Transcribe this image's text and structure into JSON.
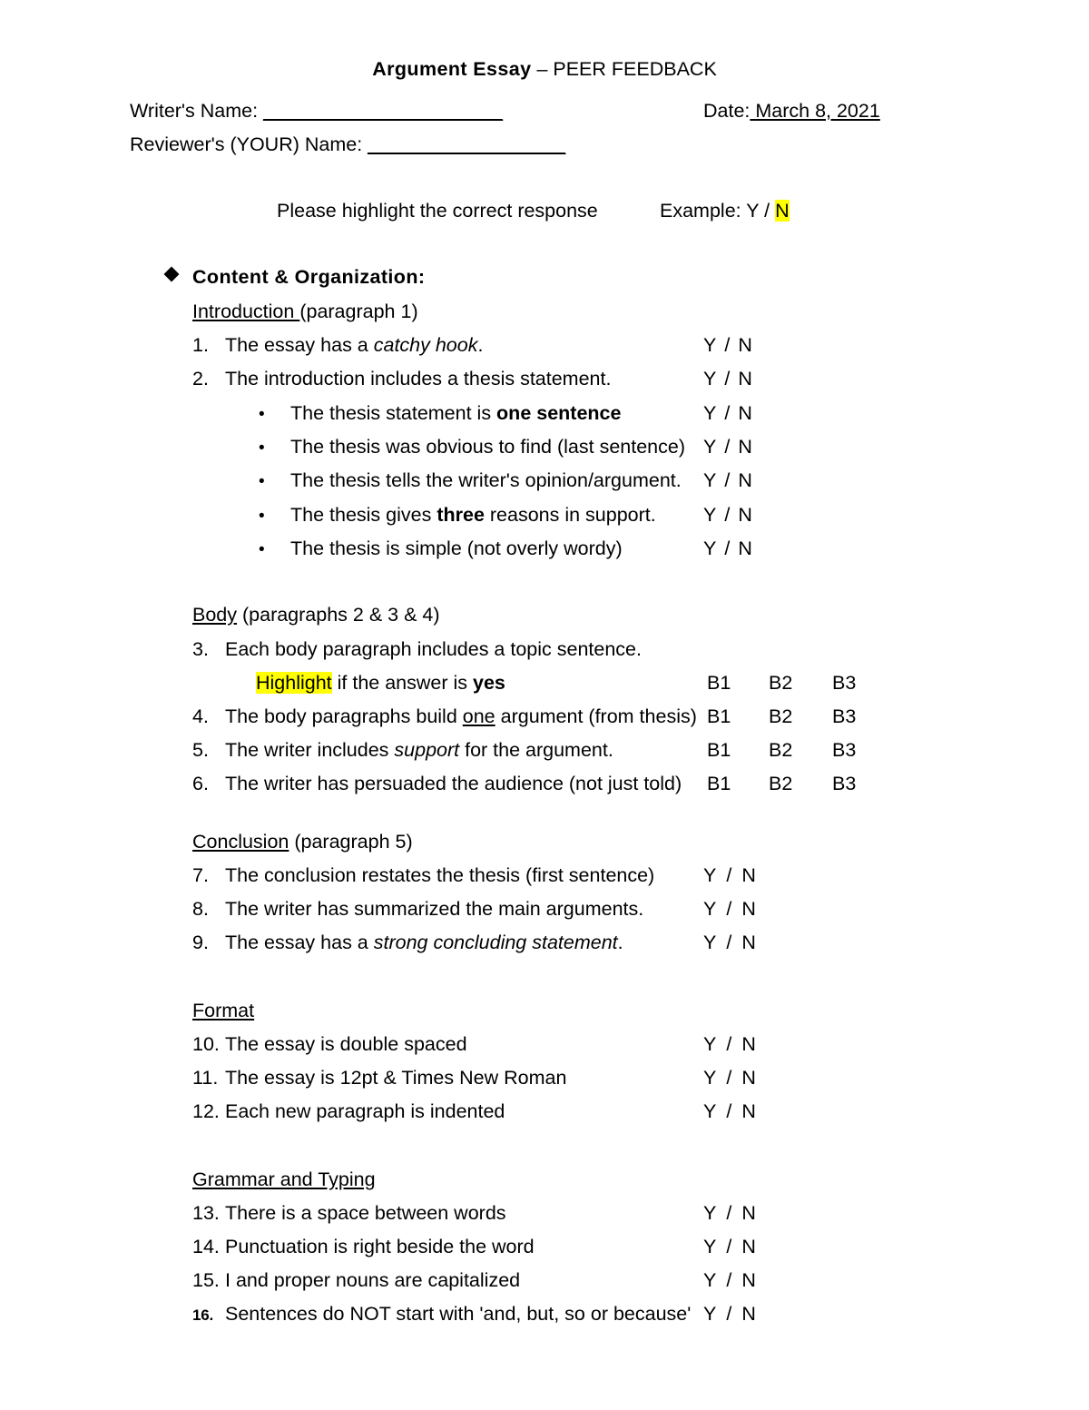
{
  "document": {
    "title_bold": "Argument Essay",
    "title_rest": " – PEER FEEDBACK",
    "writer_label": "Writer's Name: ",
    "writer_blank": "_______________________",
    "date_label": "Date:",
    "date_value": " March 8, 2021 ",
    "reviewer_label": "Reviewer's (YOUR) Name: ",
    "reviewer_blank": "___________________",
    "instruction": "Please highlight the correct response",
    "example_label": "Example: Y  /  ",
    "example_highlight": "N",
    "section_heading": "Content & Organization:"
  },
  "answers": {
    "yes": "Y",
    "slash": "/",
    "no": "N",
    "b1": "B1",
    "b2": "B2",
    "b3": "B3"
  },
  "subsections": {
    "introduction": {
      "name": "Introduction ",
      "detail": "(paragraph 1)"
    },
    "body": {
      "name": "Body",
      "detail": " (paragraphs 2 & 3 & 4)"
    },
    "conclusion": {
      "name": "Conclusion",
      "detail": " (paragraph 5)"
    },
    "format": {
      "name": "Format",
      "detail": ""
    },
    "grammar": {
      "name": "Grammar and Typing",
      "detail": ""
    }
  },
  "items": {
    "n1": {
      "number": "1.",
      "text_a": "The essay has a ",
      "text_italic": "catchy hook",
      "text_b": "."
    },
    "n2": {
      "number": "2.",
      "text_a": "The introduction includes a thesis statement."
    },
    "b1": {
      "text_a": "The thesis statement is ",
      "text_bold": "one sentence"
    },
    "b2": {
      "text_a": "The thesis was obvious to find (last sentence)"
    },
    "b3": {
      "text_a": "The thesis tells the writer's opinion/argument."
    },
    "b4": {
      "text_a": "The thesis gives ",
      "text_bold": "three",
      "text_b": " reasons in support."
    },
    "b5": {
      "text_a": "The thesis is simple (not overly wordy)"
    },
    "n3": {
      "number": "3.",
      "text_a": "Each body paragraph includes a topic sentence."
    },
    "n3sub": {
      "highlight": "Highlight",
      "text_a": " if the answer is ",
      "text_bold": "yes"
    },
    "n4": {
      "number": "4.",
      "text_a": "The body paragraphs build ",
      "text_underline": "one",
      "text_b": " argument (from thesis)"
    },
    "n5": {
      "number": "5.",
      "text_a": "The writer includes ",
      "text_italic": "support",
      "text_b": " for the argument."
    },
    "n6": {
      "number": "6.",
      "text_a": "The writer has persuaded the audience (not just told)"
    },
    "n7": {
      "number": "7.",
      "text_a": "The conclusion restates the thesis (first sentence)"
    },
    "n8": {
      "number": "8.",
      "text_a": "The writer has summarized the main arguments."
    },
    "n9": {
      "number": "9.",
      "text_a": "The essay has a ",
      "text_italic": "strong concluding statement",
      "text_b": "."
    },
    "n10": {
      "number": "10.",
      "text_a": "The essay is double spaced"
    },
    "n11": {
      "number": "11.",
      "text_a": "The essay is 12pt & Times New Roman"
    },
    "n12": {
      "number": "12.",
      "text_a": "Each new paragraph is indented"
    },
    "n13": {
      "number": "13.",
      "text_a": "There is a space between words"
    },
    "n14": {
      "number": "14.",
      "text_a": "Punctuation is right beside the word"
    },
    "n15": {
      "number": "15.",
      "text_a": "I and proper nouns are capitalized"
    },
    "n16": {
      "number": "16.",
      "text_a": "Sentences do NOT start with 'and, but, so or because'"
    }
  },
  "colors": {
    "highlight": "#FFFF00",
    "text": "#000000",
    "background": "#FFFFFF"
  }
}
